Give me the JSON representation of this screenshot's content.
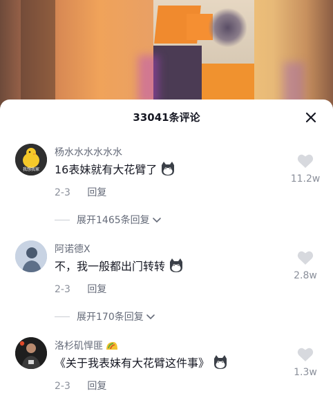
{
  "sheet": {
    "title": "33041条评论",
    "close_label": "✕"
  },
  "comments": [
    {
      "username": "杨水水水水水水",
      "avatar_text": "我想我家",
      "text": "16表妹就有大花臂了",
      "date": "2-3",
      "reply_label": "回复",
      "likes": "11.2w",
      "expand_label": "展开1465条回复"
    },
    {
      "username": "阿诺德X",
      "text": "不，我一般都出门转转",
      "date": "2-3",
      "reply_label": "回复",
      "likes": "2.8w",
      "expand_label": "展开170条回复"
    },
    {
      "username": "洛杉矶悍匪",
      "text": "《关于我表妹有大花臂这件事》",
      "date": "2-3",
      "reply_label": "回复",
      "likes": "1.3w"
    }
  ],
  "icons": {
    "close": "close-icon",
    "like": "heart-icon",
    "expand": "chevron-down-icon",
    "emoji": "cat-emoji-icon",
    "badge": "taco-emoji-icon"
  }
}
